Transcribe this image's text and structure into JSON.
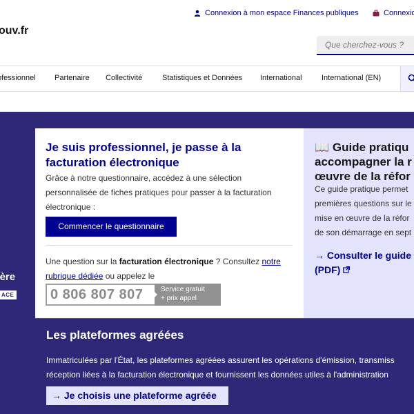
{
  "header": {
    "brand_fragment": "ouv.fr",
    "links": {
      "finances": "Connexion à mon espace Finances publiques",
      "connexion": "Connexion"
    },
    "search_placeholder": "Que cherchez-vous ?"
  },
  "nav": {
    "items": [
      "ofessionnel",
      "Partenaire",
      "Collectivité",
      "Statistiques et Données",
      "International",
      "International (EN)"
    ]
  },
  "hero": {
    "left_fragment": "'ère",
    "left_tag": "ACE"
  },
  "card_pro": {
    "title": "Je suis professionnel, je passe à la facturation électronique",
    "description": "Grâce à notre questionnaire, accédez à une sélection personnalisée de fiches pratiques pour passer à la facturation électronique :",
    "button": "Commencer le questionnaire",
    "question_prefix": "Une question sur la ",
    "question_bold": "facturation électronique",
    "question_middle": " ? Consultez ",
    "question_link": "notre rubrique dédiée",
    "question_suffix": " ou appelez le",
    "phone_number": "0 806 807 807",
    "phone_tag_line1": "Service gratuit",
    "phone_tag_line2": "+ prix appel"
  },
  "card_guide": {
    "title_line1": "Guide pratiqu",
    "title_line2": "accompagner la r",
    "title_line3": "œuvre de la réfor",
    "desc_line1": "Ce guide pratique permet",
    "desc_line2": "premières questions sur le",
    "desc_line3": "mise en œuvre de la réfor",
    "desc_line4": "de son démarrage en sept",
    "link_line1": "Consulter le guide",
    "link_line2": "(PDF)"
  },
  "platforms": {
    "title": "Les plateformes agréées",
    "desc_line1": "Immatriculées par l'État, les plateformes agréées assurent les opérations d'émission, transmiss",
    "desc_line2": "réception liées à la facturation électronique et fournissent les données utiles à l'administration",
    "button": "Je choisis une plateforme agréée"
  },
  "colors": {
    "primary_blue": "#000091",
    "band_purple": "#2f2878",
    "light_blue": "#e3e3fd"
  }
}
